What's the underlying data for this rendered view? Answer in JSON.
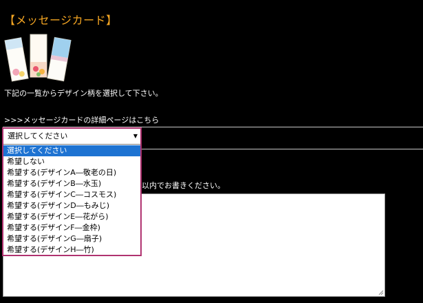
{
  "page": {
    "title": "【メッセージカード】",
    "instruction": "下記の一覧からデザイン柄を選択して下さい。",
    "detail_link": ">>>メッセージカードの詳細ページはこちら",
    "textarea_label_partial": "以内でお書きください。"
  },
  "card_images_icon": "message-card-samples",
  "select": {
    "current_value": "選択してください",
    "options": [
      "選択してください",
      "希望しない",
      "希望する(デザインA―敬老の日)",
      "希望する(デザインB―水玉)",
      "希望する(デザインC―コスモス)",
      "希望する(デザインD―もみじ)",
      "希望する(デザインE―花がら)",
      "希望する(デザインF―金枠)",
      "希望する(デザインG―扇子)",
      "希望する(デザインH―竹)"
    ],
    "highlighted_index": 0
  },
  "colors": {
    "title": "#f5a623",
    "dropdown_border": "#b03270",
    "highlight": "#1e73d2"
  }
}
